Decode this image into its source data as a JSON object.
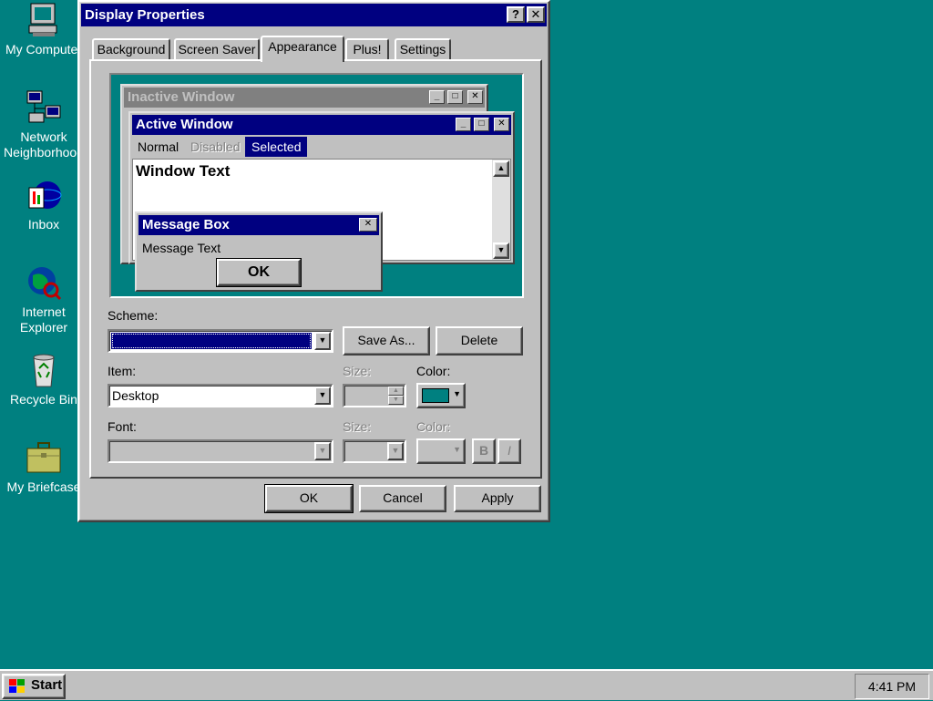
{
  "desktop": {
    "background_color": "#008080",
    "icons": [
      {
        "label": "My Computer",
        "icon": "computer-icon"
      },
      {
        "label": "Network Neighborhood",
        "line1": "Network",
        "line2": "Neighborhood",
        "icon": "network-icon"
      },
      {
        "label": "Inbox",
        "icon": "inbox-icon"
      },
      {
        "label": "Internet Explorer",
        "line1": "Internet",
        "line2": "Explorer",
        "icon": "internet-explorer-icon"
      },
      {
        "label": "Recycle Bin",
        "icon": "recycle-bin-icon"
      },
      {
        "label": "My Briefcase",
        "icon": "briefcase-icon"
      }
    ]
  },
  "dialog": {
    "title": "Display Properties",
    "help_glyph": "?",
    "close_glyph": "✕",
    "tabs": [
      {
        "label": "Background",
        "active": false
      },
      {
        "label": "Screen Saver",
        "active": false
      },
      {
        "label": "Appearance",
        "active": true
      },
      {
        "label": "Plus!",
        "active": false
      },
      {
        "label": "Settings",
        "active": false
      }
    ],
    "preview": {
      "inactive_title": "Inactive Window",
      "active_title": "Active Window",
      "menu": {
        "normal": "Normal",
        "disabled": "Disabled",
        "selected": "Selected"
      },
      "window_text": "Window Text",
      "message_box": {
        "title": "Message Box",
        "text": "Message Text",
        "ok": "OK"
      }
    },
    "scheme": {
      "label": "Scheme:",
      "value": "",
      "save_as": "Save As...",
      "delete": "Delete"
    },
    "item": {
      "label": "Item:",
      "value": "Desktop",
      "size_label": "Size:",
      "color_label": "Color:",
      "color_value": "#008080"
    },
    "font": {
      "label": "Font:",
      "size_label": "Size:",
      "color_label": "Color:",
      "bold": "B",
      "italic": "I"
    },
    "buttons": {
      "ok": "OK",
      "cancel": "Cancel",
      "apply": "Apply"
    }
  },
  "taskbar": {
    "start_label": "Start",
    "clock": "4:41 PM"
  }
}
